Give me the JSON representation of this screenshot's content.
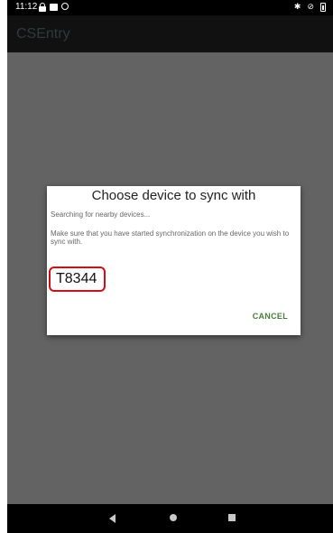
{
  "status_bar": {
    "time": "11:12",
    "left_icons": [
      "lock-icon",
      "message-icon",
      "circle-icon"
    ],
    "right_icons": [
      "bluetooth-icon",
      "no-signal-icon",
      "battery-icon"
    ]
  },
  "app_bar": {
    "title": "CSEntry"
  },
  "dialog": {
    "title": "Choose device to sync with",
    "status": "Searching for nearby devices...",
    "instructions": "Make sure that you have started synchronization on the device you wish to sync with.",
    "devices": [
      "T8344"
    ],
    "cancel_label": "CANCEL",
    "highlight_color": "#d10e16",
    "button_color": "#4b7c3b"
  },
  "nav_bar": {
    "buttons": [
      "back-icon",
      "home-icon",
      "recents-icon"
    ]
  }
}
